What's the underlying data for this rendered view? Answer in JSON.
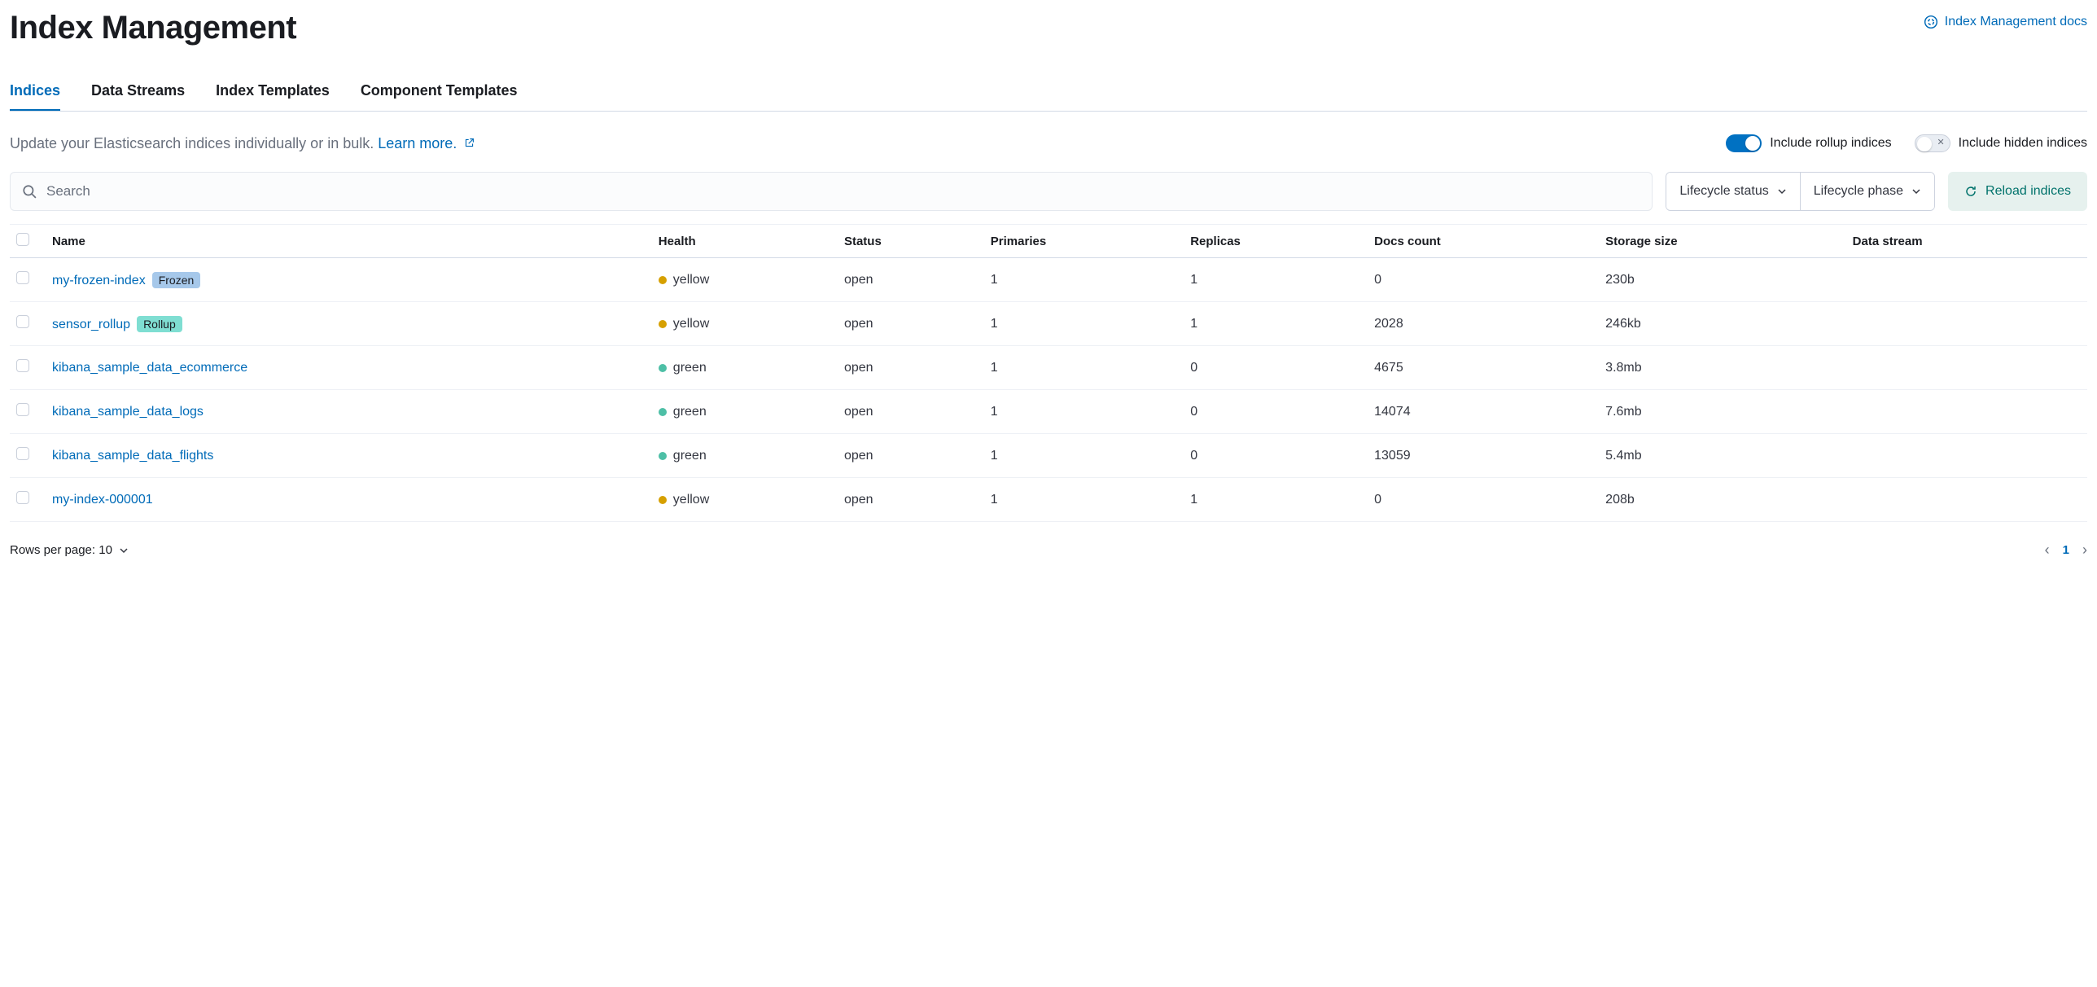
{
  "header": {
    "title": "Index Management",
    "docs_link": "Index Management docs"
  },
  "tabs": [
    {
      "label": "Indices",
      "active": true
    },
    {
      "label": "Data Streams",
      "active": false
    },
    {
      "label": "Index Templates",
      "active": false
    },
    {
      "label": "Component Templates",
      "active": false
    }
  ],
  "description": {
    "text": "Update your Elasticsearch indices individually or in bulk. ",
    "learn_more": "Learn more."
  },
  "toggles": {
    "rollup": {
      "label": "Include rollup indices",
      "on": true
    },
    "hidden": {
      "label": "Include hidden indices",
      "on": false
    }
  },
  "controls": {
    "search_placeholder": "Search",
    "filter_status": "Lifecycle status",
    "filter_phase": "Lifecycle phase",
    "reload": "Reload indices"
  },
  "columns": {
    "name": "Name",
    "health": "Health",
    "status": "Status",
    "primaries": "Primaries",
    "replicas": "Replicas",
    "docs": "Docs count",
    "storage": "Storage size",
    "ds": "Data stream"
  },
  "rows": [
    {
      "name": "my-frozen-index",
      "badge": "Frozen",
      "badge_class": "badge-frozen",
      "health": "yellow",
      "status": "open",
      "primaries": "1",
      "replicas": "1",
      "docs": "0",
      "storage": "230b",
      "ds": ""
    },
    {
      "name": "sensor_rollup",
      "badge": "Rollup",
      "badge_class": "badge-rollup",
      "health": "yellow",
      "status": "open",
      "primaries": "1",
      "replicas": "1",
      "docs": "2028",
      "storage": "246kb",
      "ds": ""
    },
    {
      "name": "kibana_sample_data_ecommerce",
      "badge": "",
      "badge_class": "",
      "health": "green",
      "status": "open",
      "primaries": "1",
      "replicas": "0",
      "docs": "4675",
      "storage": "3.8mb",
      "ds": ""
    },
    {
      "name": "kibana_sample_data_logs",
      "badge": "",
      "badge_class": "",
      "health": "green",
      "status": "open",
      "primaries": "1",
      "replicas": "0",
      "docs": "14074",
      "storage": "7.6mb",
      "ds": ""
    },
    {
      "name": "kibana_sample_data_flights",
      "badge": "",
      "badge_class": "",
      "health": "green",
      "status": "open",
      "primaries": "1",
      "replicas": "0",
      "docs": "13059",
      "storage": "5.4mb",
      "ds": ""
    },
    {
      "name": "my-index-000001",
      "badge": "",
      "badge_class": "",
      "health": "yellow",
      "status": "open",
      "primaries": "1",
      "replicas": "1",
      "docs": "0",
      "storage": "208b",
      "ds": ""
    }
  ],
  "footer": {
    "rows_per_page_label": "Rows per page: 10",
    "page": "1"
  }
}
